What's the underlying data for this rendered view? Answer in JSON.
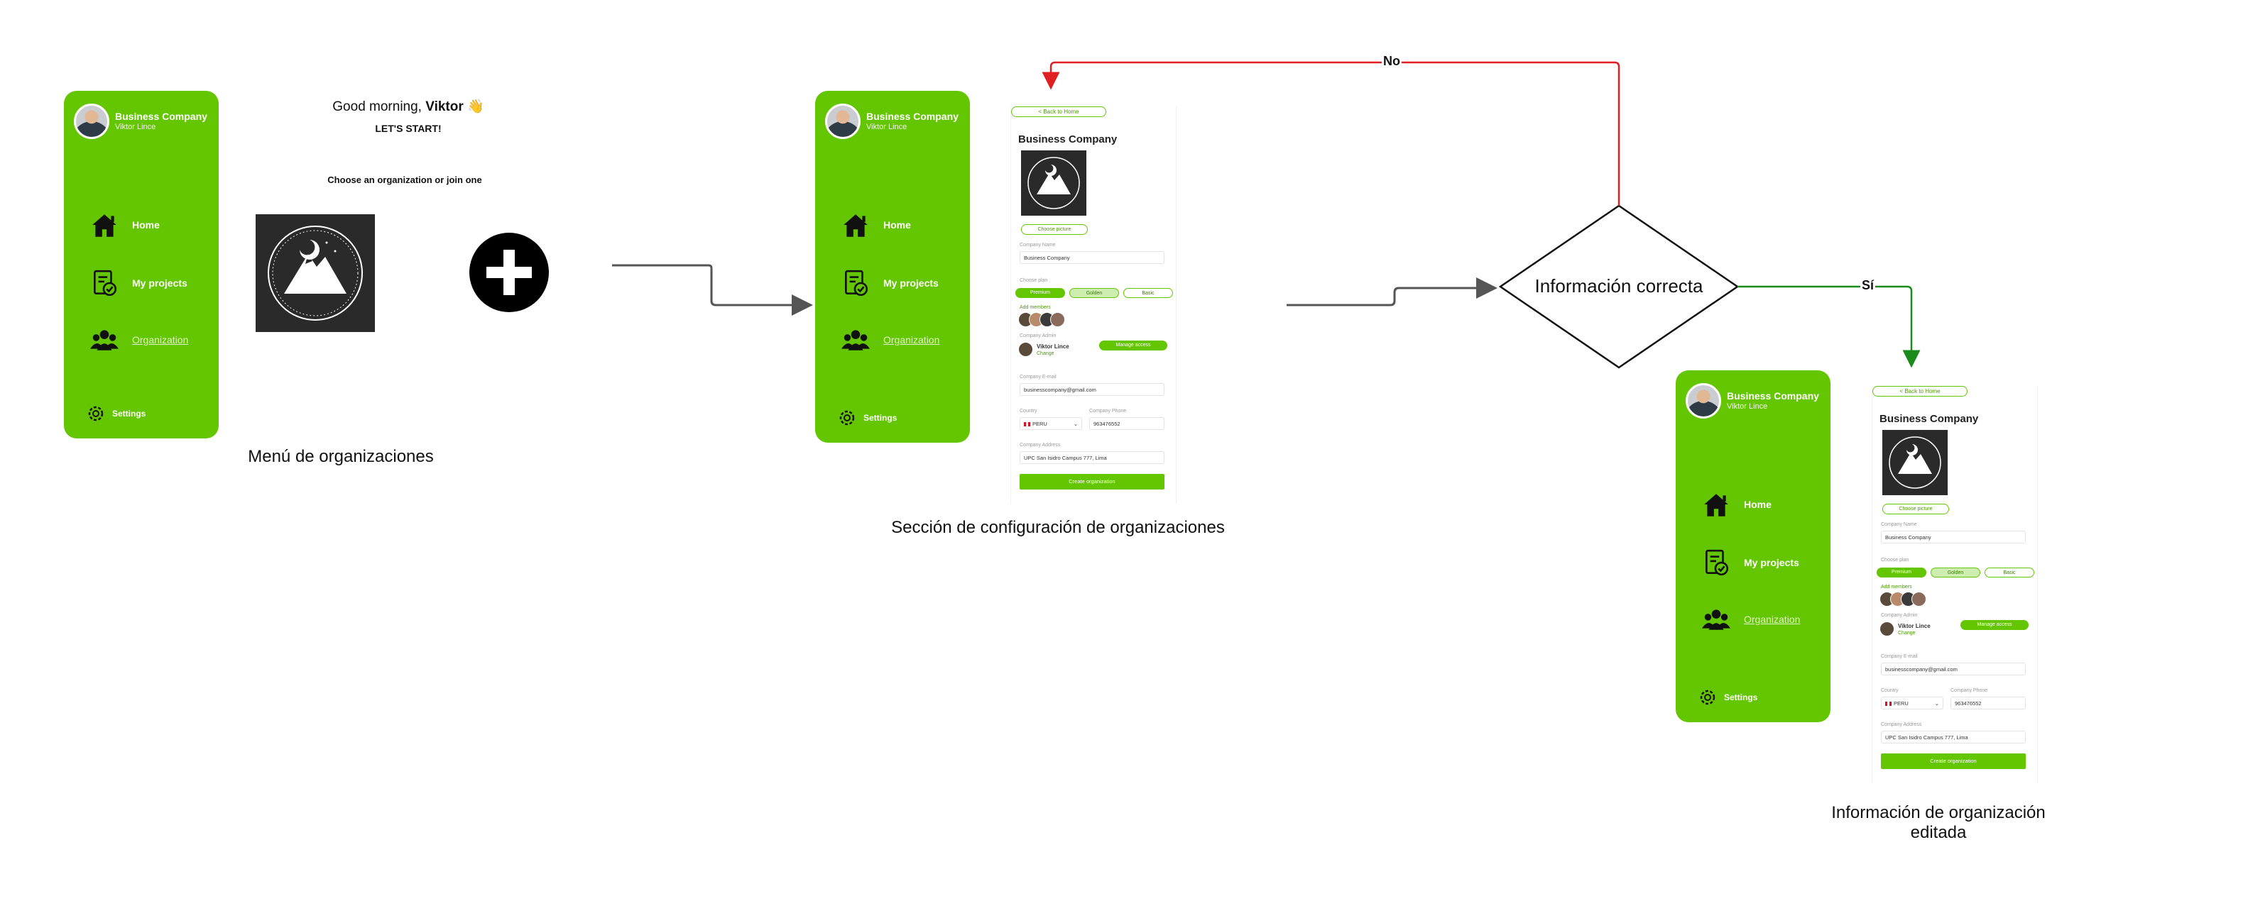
{
  "sidebar": {
    "company": "Business Company",
    "user": "Viktor Lince",
    "items": [
      {
        "label": "Home",
        "icon": "house-icon"
      },
      {
        "label": "My projects",
        "icon": "projects-icon"
      },
      {
        "label": "Organization",
        "icon": "people-icon"
      }
    ],
    "settings": "Settings"
  },
  "welcome": {
    "greeting": "Good morning,",
    "name": "Viktor",
    "emoji": "👋",
    "start": "LET'S START!",
    "choose": "Choose an organization or join one"
  },
  "form": {
    "back": "< Back to Home",
    "title": "Business Company",
    "choose_picture": "Choose picture",
    "company_name_label": "Company Name",
    "company_name": "Business Company",
    "plan_label": "Choose plan",
    "plans": [
      "Premium",
      "Golden",
      "Basic"
    ],
    "add_members": "Add members",
    "admin_label": "Company Admin",
    "admin_name": "Viktor Lince",
    "admin_change": "Change",
    "manage_access": "Manage access",
    "email_label": "Company E-mail",
    "email": "businesscompany@gmail.com",
    "country_label": "Country",
    "country": "PERU",
    "phone_label": "Company Phone",
    "phone": "963476552",
    "address_label": "Company Address",
    "address": "UPC San Isidro Campus 777, Lima",
    "create": "Create organization"
  },
  "captions": {
    "menu": "Menú de organizaciones",
    "config": "Sección de configuración de organizaciones",
    "edited_line1": "Información de organización",
    "edited_line2": "editada"
  },
  "decision": {
    "label": "Información correcta",
    "no": "No",
    "yes": "Sí"
  },
  "colors": {
    "brand_green": "#63c600",
    "no_edge": "#e02020",
    "yes_edge": "#1a8a1a",
    "flow_edge": "#555555"
  }
}
